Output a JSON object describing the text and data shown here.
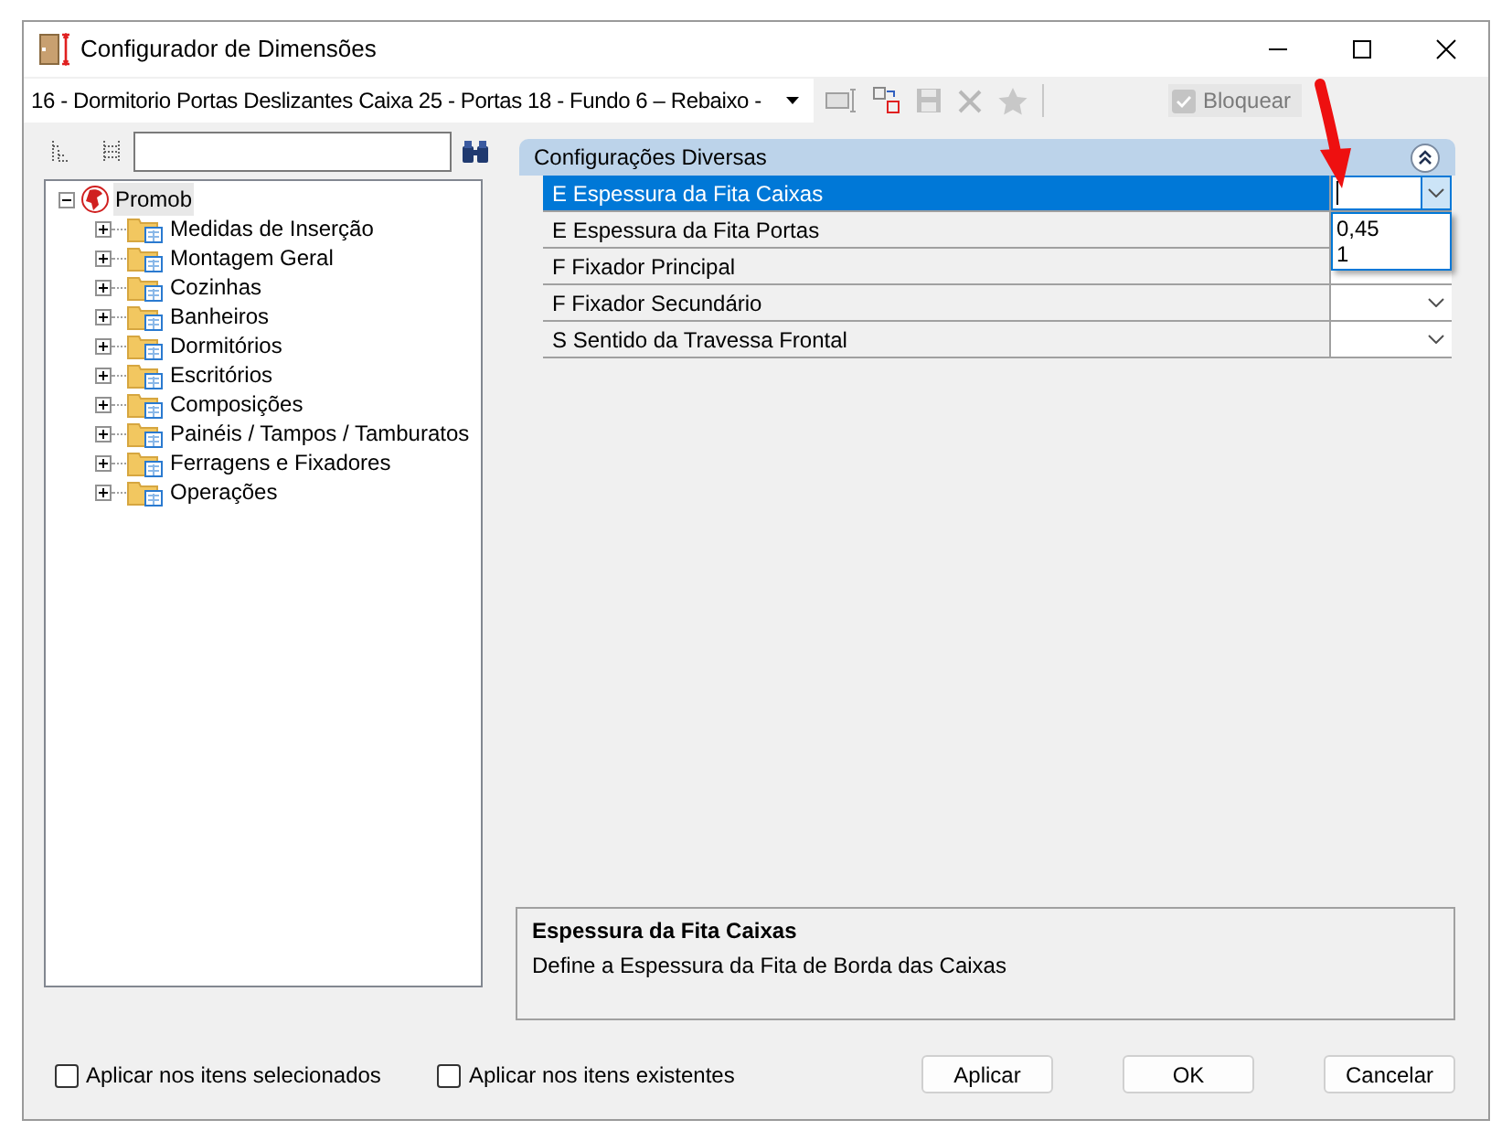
{
  "window": {
    "title": "Configurador de Dimensões"
  },
  "toolbar": {
    "item_combo": "16 - Dormitorio Portas Deslizantes Caixa 25 - Portas 18 - Fundo 6 – Rebaixo -",
    "lock": {
      "label": "Bloquear",
      "checked": true,
      "disabled": true
    }
  },
  "tree": {
    "items": [
      {
        "label": "Promob",
        "selected": true,
        "expanded": true,
        "children": [
          {
            "label": "Medidas de Inserção",
            "selected": false,
            "expanded": false
          },
          {
            "label": "Montagem Geral",
            "selected": false,
            "expanded": false
          },
          {
            "label": "Cozinhas",
            "selected": false,
            "expanded": false
          },
          {
            "label": "Banheiros",
            "selected": false,
            "expanded": false
          },
          {
            "label": "Dormitórios",
            "selected": false,
            "expanded": false
          },
          {
            "label": "Escritórios",
            "selected": false,
            "expanded": false
          },
          {
            "label": "Composições",
            "selected": false,
            "expanded": false
          },
          {
            "label": "Painéis / Tampos / Tamburatos",
            "selected": false,
            "expanded": false
          },
          {
            "label": "Ferragens e Fixadores",
            "selected": false,
            "expanded": false
          },
          {
            "label": "Operações",
            "selected": false,
            "expanded": false
          }
        ]
      }
    ]
  },
  "property_grid": {
    "category": "Configurações Diversas",
    "rows": [
      {
        "name": "E Espessura da Fita Caixas",
        "selected": true
      },
      {
        "name": "E Espessura da Fita Portas",
        "selected": false
      },
      {
        "name": "F Fixador Principal",
        "selected": false
      },
      {
        "name": "F Fixador Secundário",
        "selected": false
      },
      {
        "name": "S Sentido da Travessa Frontal",
        "selected": false
      }
    ],
    "open_dropdown": [
      "0,45",
      "1"
    ]
  },
  "description": {
    "title": "Espessura da Fita Caixas",
    "text": "Define a Espessura da Fita de Borda das Caixas"
  },
  "options": [
    {
      "label": "Aplicar nos itens selecionados",
      "checked": false
    },
    {
      "label": "Aplicar nos itens existentes",
      "checked": false
    }
  ],
  "buttons": [
    "Aplicar",
    "OK",
    "Cancelar"
  ]
}
